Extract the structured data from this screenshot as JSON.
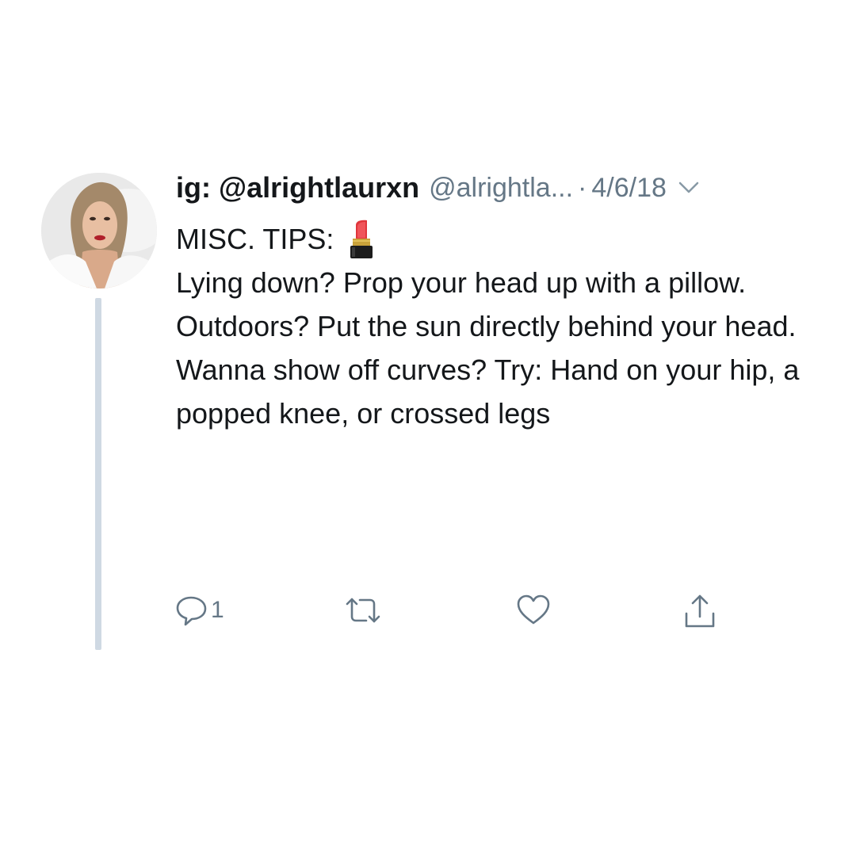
{
  "tweet": {
    "display_name": "ig: @alrightlaurxn",
    "handle": "@alrightla...",
    "separator": "·",
    "date": "4/6/18",
    "lines": [
      "MISC. TIPS:",
      "Lying down? Prop your head up with a pillow.",
      "Outdoors? Put the sun directly behind your head.",
      "Wanna show off curves? Try: Hand on your hip, a popped knee, or crossed legs"
    ],
    "title_emoji": "lipstick-icon",
    "avatar": "profile-photo",
    "actions": {
      "reply_icon": "reply-icon",
      "reply_count": "1",
      "retweet_icon": "retweet-icon",
      "like_icon": "heart-icon",
      "share_icon": "share-icon"
    }
  },
  "colors": {
    "text": "#14171a",
    "secondary": "#657786",
    "thread_line": "#cfd9e3",
    "background": "#ffffff"
  }
}
